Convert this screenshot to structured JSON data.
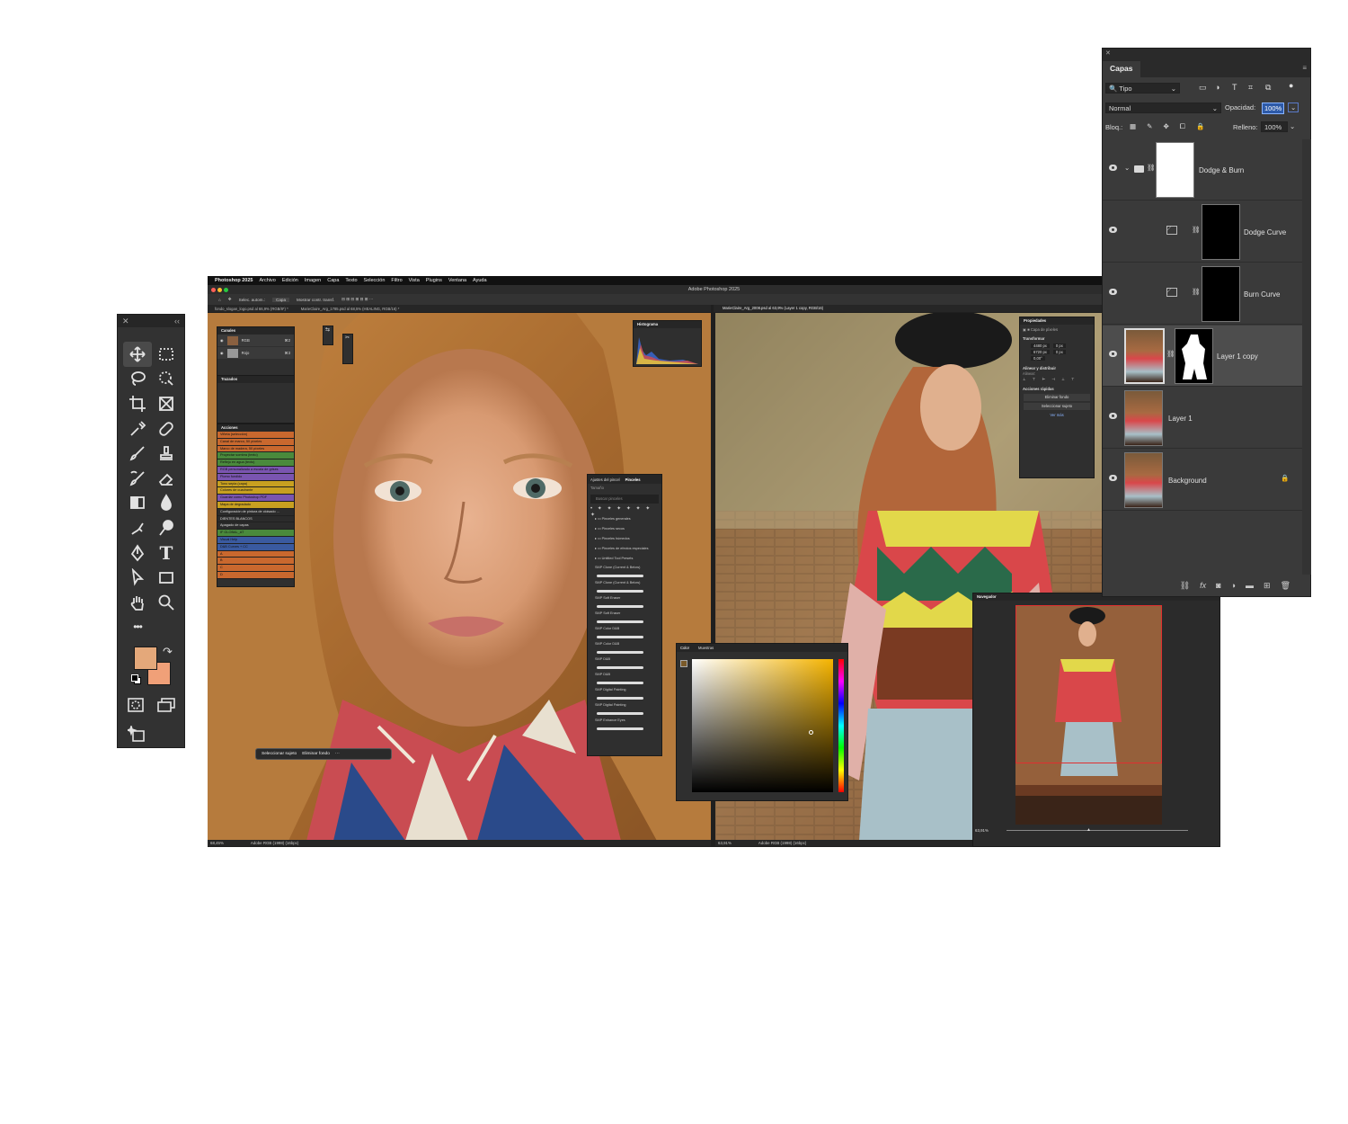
{
  "tools_panel": {
    "close_glyph": "✕",
    "collapse_glyph": "‹‹",
    "tools": [
      "move-tool",
      "rectangular-marquee-tool",
      "lasso-tool",
      "quick-selection-tool",
      "crop-tool",
      "frame-tool",
      "eyedropper-tool",
      "spot-healing-brush-tool",
      "brush-tool",
      "clone-stamp-tool",
      "history-brush-tool",
      "eraser-tool",
      "gradient-tool",
      "blur-tool",
      "smudge-tool",
      "dodge-tool",
      "pen-tool",
      "type-tool",
      "path-selection-tool",
      "rectangle-tool",
      "hand-tool",
      "zoom-tool",
      "edit-toolbar",
      "quick-mask",
      "screen-mode",
      "generative-ai"
    ],
    "type_glyph": "T",
    "more_glyph": "•••",
    "foreground_color": "#e4a87a",
    "background_color": "#f0a078"
  },
  "menubar": {
    "apple": "",
    "items": [
      "Photoshop 2025",
      "Archivo",
      "Edición",
      "Imagen",
      "Capa",
      "Texto",
      "Selección",
      "Filtro",
      "Vista",
      "Plugins",
      "Ventana",
      "Ayuda"
    ]
  },
  "window": {
    "title": "Adobe Photoshop 2025",
    "options": [
      "Selec. autom.:",
      "Capa",
      "Mostrar contr. transf."
    ],
    "tabs_left": [
      "fondo_slogan_logo.psd al 66,9% (RGB/8*) *",
      "MarieClaire_Arg_1785.psd al 68,5% (HEALING, RGB/16) *"
    ],
    "tab_right": "MarieClaire_Arg_2008.psd al 63,9% (Layer 1 copy, RGB/16)",
    "status_left": [
      "68,45%",
      "Adobe RGB (1998) (16bpc)"
    ],
    "status_right": [
      "63,91%",
      "Adobe RGB (1998) (16bpc)"
    ]
  },
  "channels_panel": {
    "title": "Canales",
    "rows": [
      {
        "name": "RGB",
        "shortcut": "⌘2"
      },
      {
        "name": "Rojo",
        "shortcut": "⌘3"
      }
    ]
  },
  "paths_panel": {
    "title": "Trazados"
  },
  "actions_panel": {
    "title": "Acciones",
    "items": [
      {
        "label": "Viñeta (selección)",
        "color": "#c9682e"
      },
      {
        "label": "Canal de marco, 50 píxeles",
        "color": "#c9682e"
      },
      {
        "label": "Marco de madera, 50 píxeles",
        "color": "#c9682e"
      },
      {
        "label": "Proyectar sombra (texto)",
        "color": "#4a8a3c"
      },
      {
        "label": "Reflejo en agua (texto)",
        "color": "#4a8a3c"
      },
      {
        "label": "RGB personalizado a escala de grises",
        "color": "#7a55b0"
      },
      {
        "label": "Plomo fundido",
        "color": "#7a55b0"
      },
      {
        "label": "Tono sepia (capa)",
        "color": "#c8a020"
      },
      {
        "label": "Colores de cuadrante",
        "color": "#c8a020"
      },
      {
        "label": "Guardar como Photoshop PDF",
        "color": "#7a55b0"
      },
      {
        "label": "Mapa de degradado",
        "color": "#c8a020"
      },
      {
        "label": "Configuración de pintura de cloisado ...",
        "color": "#2b2b2b"
      },
      {
        "label": "DIENTES BLANCOS",
        "color": "#2b2b2b"
      },
      {
        "label": "Apagado de capas",
        "color": "#2b2b2b"
      },
      {
        "label": "IF GLOBAL_AT",
        "color": "#4a8a3c"
      },
      {
        "label": "Visual Help",
        "color": "#3a5aa0"
      },
      {
        "label": "D&B Curves + CC",
        "color": "#3a5aa0"
      },
      {
        "label": "A",
        "color": "#c9682e"
      },
      {
        "label": "B",
        "color": "#c9682e"
      },
      {
        "label": "C",
        "color": "#c9682e"
      },
      {
        "label": "D",
        "color": "#c9682e"
      }
    ]
  },
  "histogram_panel": {
    "title": "Histograma"
  },
  "brushes_panel": {
    "tabs": [
      "Ajustes del pincel",
      "Pinceles"
    ],
    "size_label": "Tamaño",
    "search_placeholder": "Buscar pinceles",
    "folders": [
      "Pinceles generales",
      "Pinceles secos",
      "Pinceles húmedos",
      "Pinceles de efectos especiales",
      "Untitled Tool Presets"
    ],
    "brushes": [
      "SMP Clone (Current & Below)",
      "SMP Clone (Current & Below)",
      "SMP Soft Eraser",
      "SMP Soft Eraser",
      "SMP Color D&B",
      "SMP Color D&B",
      "SMP D&B",
      "SMP D&B",
      "SMP Digital Painting",
      "SMP Digital Painting",
      "SMP Enhance Eyes"
    ]
  },
  "task_bar": {
    "buttons": [
      "Seleccionar sujeto",
      "Eliminar fondo"
    ]
  },
  "color_panel": {
    "tabs": [
      "Color",
      "Muestras"
    ],
    "hue_color": "#f5b400"
  },
  "properties_panel": {
    "title": "Propiedades",
    "subtitle": "Capa de píxeles",
    "transform_title": "Transformar",
    "width": "4480 px",
    "height": "6720 px",
    "x": "0 px",
    "y": "0 px",
    "angle": "0,00°",
    "align_title": "Alinear y distribuir",
    "align_label": "Alinear:",
    "quick_actions_title": "Acciones rápidas",
    "quick_actions": [
      "Eliminar fondo",
      "Seleccionar sujeto"
    ],
    "more_link": "Ver más"
  },
  "navigator_panel": {
    "title": "Navegador",
    "zoom": "63,91%"
  },
  "layers_panel": {
    "tab": "Capas",
    "filter_label": "Tipo",
    "blend_mode": "Normal",
    "opacity_label": "Opacidad:",
    "opacity_value": "100%",
    "lock_label": "Bloq.:",
    "fill_label": "Relleno:",
    "fill_value": "100%",
    "layers": [
      {
        "name": "Dodge & Burn",
        "type": "group"
      },
      {
        "name": "Dodge Curve",
        "type": "curves"
      },
      {
        "name": "Burn Curve",
        "type": "curves"
      },
      {
        "name": "Layer 1 copy",
        "type": "pixel-mask",
        "selected": true
      },
      {
        "name": "Layer 1",
        "type": "pixel"
      },
      {
        "name": "Background",
        "type": "pixel",
        "locked": true
      }
    ],
    "footer_fx": "fx"
  }
}
